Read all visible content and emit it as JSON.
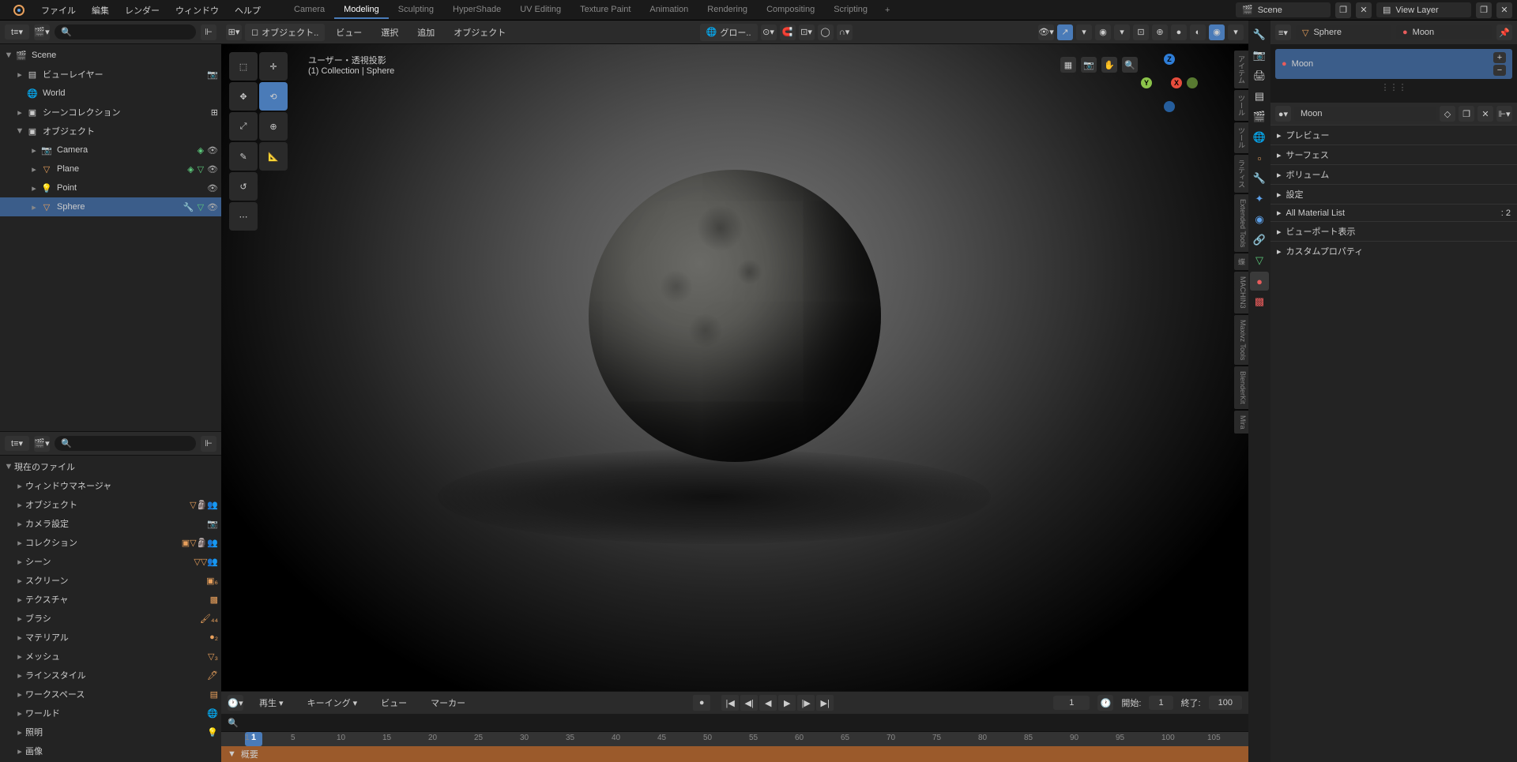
{
  "menu": {
    "file": "ファイル",
    "edit": "編集",
    "render": "レンダー",
    "window": "ウィンドウ",
    "help": "ヘルプ"
  },
  "workspaces": [
    "Camera",
    "Modeling",
    "Sculpting",
    "HyperShade",
    "UV Editing",
    "Texture Paint",
    "Animation",
    "Rendering",
    "Compositing",
    "Scripting"
  ],
  "workspace_active": 1,
  "scene_label": "Scene",
  "viewlayer_label": "View Layer",
  "outliner": {
    "root": "Scene",
    "items": [
      {
        "icon": "layer",
        "label": "ビューレイヤー"
      },
      {
        "icon": "world",
        "label": "World"
      },
      {
        "icon": "collection",
        "label": "シーンコレクション"
      },
      {
        "icon": "objects",
        "label": "オブジェクト",
        "children": [
          {
            "icon": "camera",
            "label": "Camera"
          },
          {
            "icon": "mesh",
            "label": "Plane"
          },
          {
            "icon": "light",
            "label": "Point"
          },
          {
            "icon": "mesh",
            "label": "Sphere",
            "selected": true
          }
        ]
      }
    ]
  },
  "file_panel": {
    "header": "現在のファイル",
    "items": [
      "ウィンドウマネージャ",
      "オブジェクト",
      "カメラ設定",
      "コレクション",
      "シーン",
      "スクリーン",
      "テクスチャ",
      "ブラシ",
      "マテリアル",
      "メッシュ",
      "ラインスタイル",
      "ワークスペース",
      "ワールド",
      "照明",
      "画像"
    ]
  },
  "vp_header": {
    "mode": "オブジェクト..",
    "view": "ビュー",
    "select": "選択",
    "add": "追加",
    "object": "オブジェクト",
    "shading": "グロー.."
  },
  "vp_overlay": {
    "line1": "ユーザー・透視投影",
    "line2": "(1) Collection | Sphere"
  },
  "side_tabs": [
    "アイテム",
    "ツール",
    "ツール",
    "ラティス",
    "Extended Tools",
    "蝶",
    "MACHIN3",
    "Maxivz Tools",
    "BlenderKit",
    "Mira"
  ],
  "timeline": {
    "play": "再生",
    "keying": "キーイング",
    "view": "ビュー",
    "marker": "マーカー",
    "current": 1,
    "start_label": "開始:",
    "start": 1,
    "end_label": "終了:",
    "end": 100,
    "ticks": [
      1,
      5,
      10,
      15,
      20,
      25,
      30,
      35,
      40,
      45,
      50,
      55,
      60,
      65,
      70,
      75,
      80,
      85,
      90,
      95,
      100,
      105
    ],
    "summary": "概要"
  },
  "properties": {
    "sphere": "Sphere",
    "moon": "Moon",
    "material": "Moon",
    "panels": [
      "プレビュー",
      "サーフェス",
      "ボリューム",
      "設定",
      "All Material List",
      "ビューポート表示",
      "カスタムプロパティ"
    ],
    "matlist_count": ": 2"
  }
}
